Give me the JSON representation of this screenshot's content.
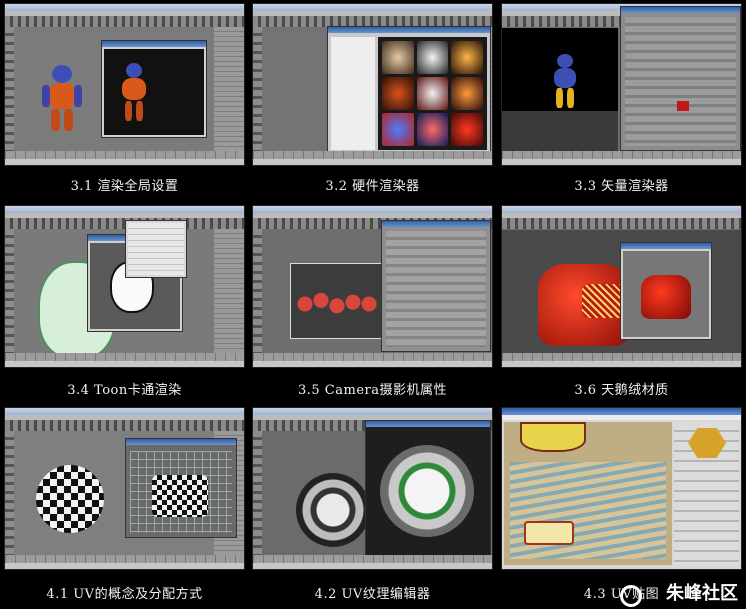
{
  "tutorials": [
    {
      "caption": "3.1 渲染全局设置"
    },
    {
      "caption": "3.2 硬件渲染器"
    },
    {
      "caption": "3.3 矢量渲染器"
    },
    {
      "caption": "3.4 Toon卡通渲染"
    },
    {
      "caption": "3.5 Camera摄影机属性"
    },
    {
      "caption": "3.6 天鹅绒材质"
    },
    {
      "caption": "4.1 UV的概念及分配方式"
    },
    {
      "caption": "4.2 UV纹理编辑器"
    },
    {
      "caption": "4.3 UV贴图"
    }
  ],
  "watermark": {
    "site": "朱峰社区",
    "icon": "spiral-logo-icon"
  },
  "colors": {
    "background": "#000000",
    "caption": "#f2f2f2",
    "maya_gray": "#6d6d6d"
  }
}
